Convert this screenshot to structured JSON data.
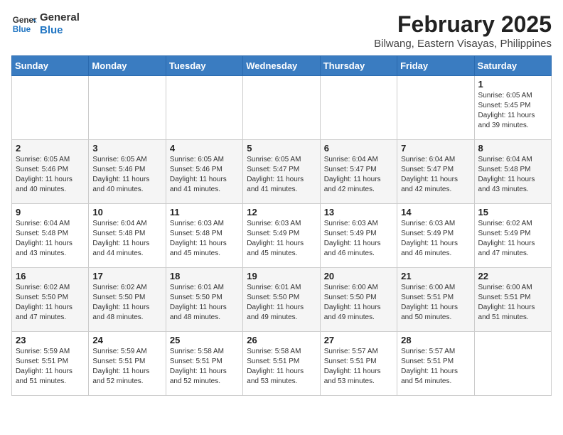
{
  "header": {
    "logo_general": "General",
    "logo_blue": "Blue",
    "month_year": "February 2025",
    "location": "Bilwang, Eastern Visayas, Philippines"
  },
  "days_of_week": [
    "Sunday",
    "Monday",
    "Tuesday",
    "Wednesday",
    "Thursday",
    "Friday",
    "Saturday"
  ],
  "weeks": [
    [
      {
        "day": "",
        "info": ""
      },
      {
        "day": "",
        "info": ""
      },
      {
        "day": "",
        "info": ""
      },
      {
        "day": "",
        "info": ""
      },
      {
        "day": "",
        "info": ""
      },
      {
        "day": "",
        "info": ""
      },
      {
        "day": "1",
        "info": "Sunrise: 6:05 AM\nSunset: 5:45 PM\nDaylight: 11 hours and 39 minutes."
      }
    ],
    [
      {
        "day": "2",
        "info": "Sunrise: 6:05 AM\nSunset: 5:46 PM\nDaylight: 11 hours and 40 minutes."
      },
      {
        "day": "3",
        "info": "Sunrise: 6:05 AM\nSunset: 5:46 PM\nDaylight: 11 hours and 40 minutes."
      },
      {
        "day": "4",
        "info": "Sunrise: 6:05 AM\nSunset: 5:46 PM\nDaylight: 11 hours and 41 minutes."
      },
      {
        "day": "5",
        "info": "Sunrise: 6:05 AM\nSunset: 5:47 PM\nDaylight: 11 hours and 41 minutes."
      },
      {
        "day": "6",
        "info": "Sunrise: 6:04 AM\nSunset: 5:47 PM\nDaylight: 11 hours and 42 minutes."
      },
      {
        "day": "7",
        "info": "Sunrise: 6:04 AM\nSunset: 5:47 PM\nDaylight: 11 hours and 42 minutes."
      },
      {
        "day": "8",
        "info": "Sunrise: 6:04 AM\nSunset: 5:48 PM\nDaylight: 11 hours and 43 minutes."
      }
    ],
    [
      {
        "day": "9",
        "info": "Sunrise: 6:04 AM\nSunset: 5:48 PM\nDaylight: 11 hours and 43 minutes."
      },
      {
        "day": "10",
        "info": "Sunrise: 6:04 AM\nSunset: 5:48 PM\nDaylight: 11 hours and 44 minutes."
      },
      {
        "day": "11",
        "info": "Sunrise: 6:03 AM\nSunset: 5:48 PM\nDaylight: 11 hours and 45 minutes."
      },
      {
        "day": "12",
        "info": "Sunrise: 6:03 AM\nSunset: 5:49 PM\nDaylight: 11 hours and 45 minutes."
      },
      {
        "day": "13",
        "info": "Sunrise: 6:03 AM\nSunset: 5:49 PM\nDaylight: 11 hours and 46 minutes."
      },
      {
        "day": "14",
        "info": "Sunrise: 6:03 AM\nSunset: 5:49 PM\nDaylight: 11 hours and 46 minutes."
      },
      {
        "day": "15",
        "info": "Sunrise: 6:02 AM\nSunset: 5:49 PM\nDaylight: 11 hours and 47 minutes."
      }
    ],
    [
      {
        "day": "16",
        "info": "Sunrise: 6:02 AM\nSunset: 5:50 PM\nDaylight: 11 hours and 47 minutes."
      },
      {
        "day": "17",
        "info": "Sunrise: 6:02 AM\nSunset: 5:50 PM\nDaylight: 11 hours and 48 minutes."
      },
      {
        "day": "18",
        "info": "Sunrise: 6:01 AM\nSunset: 5:50 PM\nDaylight: 11 hours and 48 minutes."
      },
      {
        "day": "19",
        "info": "Sunrise: 6:01 AM\nSunset: 5:50 PM\nDaylight: 11 hours and 49 minutes."
      },
      {
        "day": "20",
        "info": "Sunrise: 6:00 AM\nSunset: 5:50 PM\nDaylight: 11 hours and 49 minutes."
      },
      {
        "day": "21",
        "info": "Sunrise: 6:00 AM\nSunset: 5:51 PM\nDaylight: 11 hours and 50 minutes."
      },
      {
        "day": "22",
        "info": "Sunrise: 6:00 AM\nSunset: 5:51 PM\nDaylight: 11 hours and 51 minutes."
      }
    ],
    [
      {
        "day": "23",
        "info": "Sunrise: 5:59 AM\nSunset: 5:51 PM\nDaylight: 11 hours and 51 minutes."
      },
      {
        "day": "24",
        "info": "Sunrise: 5:59 AM\nSunset: 5:51 PM\nDaylight: 11 hours and 52 minutes."
      },
      {
        "day": "25",
        "info": "Sunrise: 5:58 AM\nSunset: 5:51 PM\nDaylight: 11 hours and 52 minutes."
      },
      {
        "day": "26",
        "info": "Sunrise: 5:58 AM\nSunset: 5:51 PM\nDaylight: 11 hours and 53 minutes."
      },
      {
        "day": "27",
        "info": "Sunrise: 5:57 AM\nSunset: 5:51 PM\nDaylight: 11 hours and 53 minutes."
      },
      {
        "day": "28",
        "info": "Sunrise: 5:57 AM\nSunset: 5:51 PM\nDaylight: 11 hours and 54 minutes."
      },
      {
        "day": "",
        "info": ""
      }
    ]
  ]
}
